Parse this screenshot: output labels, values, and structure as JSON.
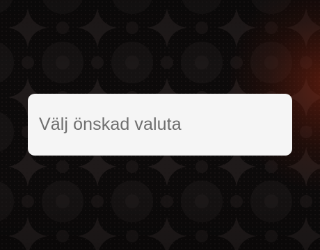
{
  "currency_select": {
    "placeholder": "Välj önskad valuta"
  },
  "colors": {
    "background": "#0c0a0a",
    "pattern": "#1a1616",
    "glow": "#8c2610",
    "field_background": "#f5f5f5",
    "placeholder_text": "#6f6f6f"
  }
}
